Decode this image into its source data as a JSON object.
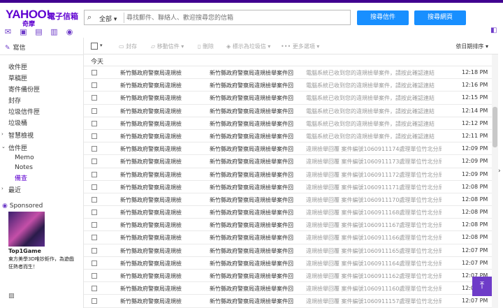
{
  "header": {
    "logo_text": "YAHOO!",
    "logo_cn": "奇摩",
    "logo_sub": "電子信箱",
    "search_scope": "全部",
    "search_placeholder": "尋找郵件、聯絡人、歡迎搜尋您的信箱",
    "search_mail_label": "搜尋信件",
    "search_web_label": "搜尋網頁"
  },
  "sidebar": {
    "compose_label": "寫信",
    "folders": [
      {
        "label": "收件匣"
      },
      {
        "label": "草稿匣"
      },
      {
        "label": "寄件備份匣"
      },
      {
        "label": "封存"
      },
      {
        "label": "垃圾信件匣"
      },
      {
        "label": "垃圾桶"
      }
    ],
    "smart_views_label": "智慧檢視",
    "mail_folders_label": "信件匣",
    "sub_folders": [
      {
        "label": "Memo"
      },
      {
        "label": "Notes"
      },
      {
        "label": "備查"
      }
    ],
    "recent_label": "最近",
    "sponsored_label": "Sponsored",
    "ad_title": "Top1Game",
    "ad_text": "東方美學3D唯妙鉅作，為遊戲狂熱者而生！"
  },
  "toolbar": {
    "archive_label": "封存",
    "move_label": "移動信件",
    "delete_label": "刪除",
    "spam_label": "標示為垃圾信",
    "more_label": "更多選項",
    "sort_label": "依日期排序"
  },
  "list": {
    "group_today": "今天",
    "rows": [
      {
        "from": "新竹縣政府警察局違規檢",
        "subject": "新竹縣政府警察局違規檢舉案件回",
        "preview": "電腦系統已收到您的違規檢舉案件，請按此確認連結",
        "time": "12:18 PM"
      },
      {
        "from": "新竹縣政府警察局違規檢",
        "subject": "新竹縣政府警察局違規檢舉案件回",
        "preview": "電腦系統已收到您的違規檢舉案件，請按此確認連結",
        "time": "12:16 PM"
      },
      {
        "from": "新竹縣政府警察局違規檢",
        "subject": "新竹縣政府警察局違規檢舉案件回",
        "preview": "電腦系統已收到您的違規檢舉案件，請按此確認連結",
        "time": "12:15 PM"
      },
      {
        "from": "新竹縣政府警察局違規檢",
        "subject": "新竹縣政府警察局違規檢舉案件回",
        "preview": "電腦系統已收到您的違規檢舉案件，請按此確認連結",
        "time": "12:14 PM"
      },
      {
        "from": "新竹縣政府警察局違規檢",
        "subject": "新竹縣政府警察局違規檢舉案件回",
        "preview": "電腦系統已收到您的違規檢舉案件，請按此確認連結",
        "time": "12:12 PM"
      },
      {
        "from": "新竹縣政府警察局違規檢",
        "subject": "新竹縣政府警察局違規檢舉案件回",
        "preview": "電腦系統已收到您的違規檢舉案件，請按此確認連結",
        "time": "12:11 PM"
      },
      {
        "from": "新竹縣政府警察局違規檢",
        "subject": "新竹縣政府警察局違規檢舉案件回",
        "preview": "違規檢舉回覆 案件編號1060911174處理單位竹北分局",
        "time": "12:09 PM"
      },
      {
        "from": "新竹縣政府警察局違規檢",
        "subject": "新竹縣政府警察局違規檢舉案件回",
        "preview": "違規檢舉回覆 案件編號1060911173處理單位竹北分局",
        "time": "12:09 PM"
      },
      {
        "from": "新竹縣政府警察局違規檢",
        "subject": "新竹縣政府警察局違規檢舉案件回",
        "preview": "違規檢舉回覆 案件編號1060911172處理單位竹北分局",
        "time": "12:09 PM"
      },
      {
        "from": "新竹縣政府警察局違規檢",
        "subject": "新竹縣政府警察局違規檢舉案件回",
        "preview": "違規檢舉回覆 案件編號1060911171處理單位竹北分局",
        "time": "12:08 PM"
      },
      {
        "from": "新竹縣政府警察局違規檢",
        "subject": "新竹縣政府警察局違規檢舉案件回",
        "preview": "違規檢舉回覆 案件編號1060911170處理單位竹北分局",
        "time": "12:08 PM"
      },
      {
        "from": "新竹縣政府警察局違規檢",
        "subject": "新竹縣政府警察局違規檢舉案件回",
        "preview": "違規檢舉回覆 案件編號1060911168處理單位竹北分局",
        "time": "12:08 PM"
      },
      {
        "from": "新竹縣政府警察局違規檢",
        "subject": "新竹縣政府警察局違規檢舉案件回",
        "preview": "違規檢舉回覆 案件編號1060911167處理單位竹北分局",
        "time": "12:08 PM"
      },
      {
        "from": "新竹縣政府警察局違規檢",
        "subject": "新竹縣政府警察局違規檢舉案件回",
        "preview": "違規檢舉回覆 案件編號1060911166處理單位竹北分局",
        "time": "12:08 PM"
      },
      {
        "from": "新竹縣政府警察局違規檢",
        "subject": "新竹縣政府警察局違規檢舉案件回",
        "preview": "違規檢舉回覆 案件編號1060911165處理單位竹北分局",
        "time": "12:07 PM"
      },
      {
        "from": "新竹縣政府警察局違規檢",
        "subject": "新竹縣政府警察局違規檢舉案件回",
        "preview": "違規檢舉回覆 案件編號1060911164處理單位竹北分局",
        "time": "12:07 PM"
      },
      {
        "from": "新竹縣政府警察局違規檢",
        "subject": "新竹縣政府警察局違規檢舉案件回",
        "preview": "違規檢舉回覆 案件編號1060911162處理單位竹北分局",
        "time": "12:07 PM"
      },
      {
        "from": "新竹縣政府警察局違規檢",
        "subject": "新竹縣政府警察局違規檢舉案件回",
        "preview": "違規檢舉回覆 案件編號1060911160處理單位竹北分局",
        "time": "12:07 PM"
      },
      {
        "from": "新竹縣政府警察局違規檢",
        "subject": "新竹縣政府警察局違規檢舉案件回",
        "preview": "違規檢舉回覆 案件編號1060911157處理單位竹北分局",
        "time": "12:07 PM"
      }
    ]
  },
  "icons": {
    "back_to_top": "arrow-up-icon"
  },
  "colors": {
    "brand": "#5f01d1",
    "top_bar": "#400090",
    "search_button": "#188fff"
  }
}
